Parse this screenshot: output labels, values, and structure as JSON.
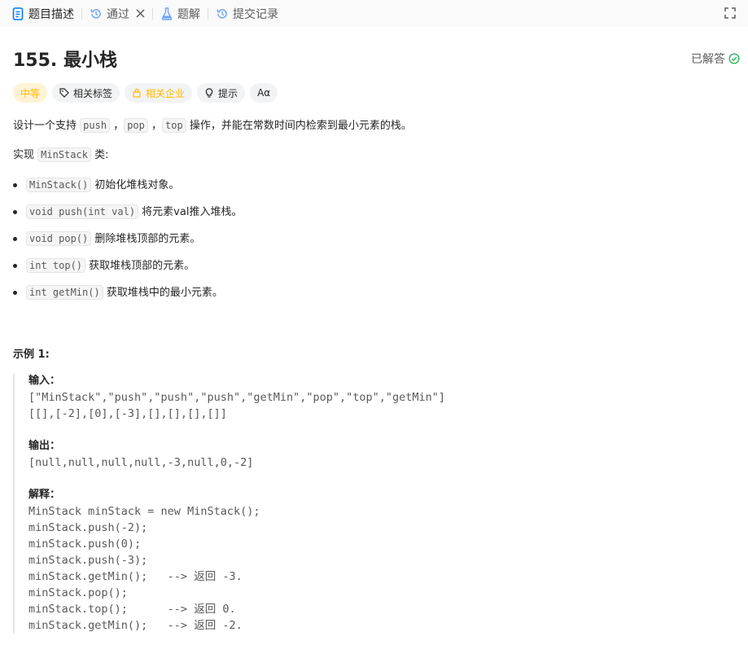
{
  "tabs": [
    {
      "label": "题目描述",
      "icon": "document-icon"
    },
    {
      "label": "通过",
      "icon": "history-icon",
      "closable": true
    },
    {
      "label": "题解",
      "icon": "flask-icon"
    },
    {
      "label": "提交记录",
      "icon": "history-icon"
    }
  ],
  "problem": {
    "title": "155. 最小栈",
    "status": "已解答",
    "tags": {
      "difficulty": "中等",
      "related_tags": "相关标签",
      "related_companies": "相关企业",
      "hint": "提示",
      "font_size": "Aα"
    },
    "description": {
      "p1_a": "设计一个支持 ",
      "p1_code1": "push",
      "p1_b": " ，",
      "p1_code2": "pop",
      "p1_c": " ，",
      "p1_code3": "top",
      "p1_d": " 操作，并能在常数时间内检索到最小元素的栈。",
      "p2_a": "实现 ",
      "p2_code": "MinStack",
      "p2_b": " 类:",
      "bullets": [
        {
          "code": "MinStack()",
          "text": " 初始化堆栈对象。"
        },
        {
          "code": "void push(int val)",
          "text": " 将元素val推入堆栈。"
        },
        {
          "code": "void pop()",
          "text": " 删除堆栈顶部的元素。"
        },
        {
          "code": "int top()",
          "text": " 获取堆栈顶部的元素。"
        },
        {
          "code": "int getMin()",
          "text": " 获取堆栈中的最小元素。"
        }
      ]
    },
    "example": {
      "title": "示例 1:",
      "input_label": "输入：",
      "input_lines": [
        "[\"MinStack\",\"push\",\"push\",\"push\",\"getMin\",\"pop\",\"top\",\"getMin\"]",
        "[[],[-2],[0],[-3],[],[],[],[]]"
      ],
      "output_label": "输出：",
      "output_lines": [
        "[null,null,null,null,-3,null,0,-2]"
      ],
      "explain_label": "解释：",
      "explain_lines": [
        "MinStack minStack = new MinStack();",
        "minStack.push(-2);",
        "minStack.push(0);",
        "minStack.push(-3);",
        "minStack.getMin();   --> 返回 -3.",
        "minStack.pop();",
        "minStack.top();      --> 返回 0.",
        "minStack.getMin();   --> 返回 -2."
      ]
    }
  },
  "colors": {
    "accent": "#ffb800",
    "solved_green": "#2db55d",
    "tab_icon_blue": "#007aff"
  }
}
